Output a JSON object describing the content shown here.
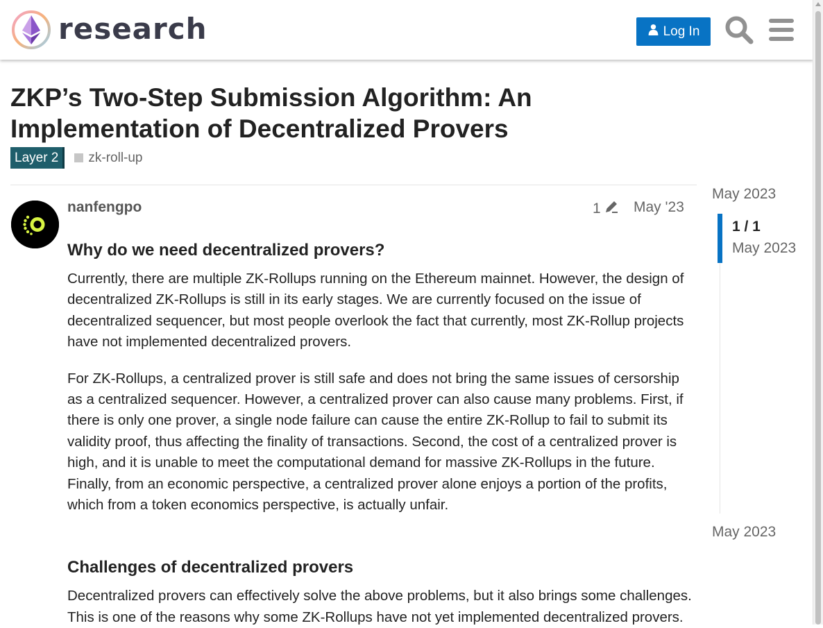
{
  "header": {
    "site_name": "research",
    "login_label": "Log In",
    "icons": [
      "research-logo-icon",
      "user-icon",
      "search-icon",
      "hamburger-menu-icon"
    ]
  },
  "topic": {
    "title": "ZKP’s Two-Step Submission Algorithm: An Implementation of Decentralized Provers",
    "category": "Layer 2",
    "tag": "zk-roll-up"
  },
  "post": {
    "username": "nanfengpo",
    "edit_count": "1",
    "date": "May '23",
    "heading_1": "Why do we need decentralized provers?",
    "paragraph_1": "Currently, there are multiple ZK-Rollups running on the Ethereum mainnet. However, the design of decentralized ZK-Rollups is still in its early stages. We are currently focused on the issue of decentralized sequencer, but most people overlook the fact that currently, most ZK-Rollup projects have not implemented decentralized provers.",
    "paragraph_2": "For ZK-Rollups, a centralized prover is still safe and does not bring the same issues of cersorship as a centralized sequencer. However, a centralized prover can also cause many problems. First, if there is only one prover, a single node failure can cause the entire ZK-Rollup to fail to submit its validity proof, thus affecting the finality of transactions. Second, the cost of a centralized prover is high, and it is unable to meet the computational demand for massive ZK-Rollups in the future. Finally, from an economic perspective, a centralized prover alone enjoys a portion of the profits, which from a token economics perspective, is actually unfair.",
    "heading_2": "Challenges of decentralized provers",
    "paragraph_3": "Decentralized provers can effectively solve the above problems, but it also brings some challenges. This is one of the reasons why some ZK-Rollups have not yet implemented decentralized provers."
  },
  "timeline": {
    "start_date": "May 2023",
    "position": "1 / 1",
    "current_date": "May 2023",
    "end_date": "May 2023"
  },
  "colors": {
    "accent": "#0873c4",
    "category_badge": "#1f5e6b",
    "text": "#222222",
    "muted": "#666666"
  }
}
